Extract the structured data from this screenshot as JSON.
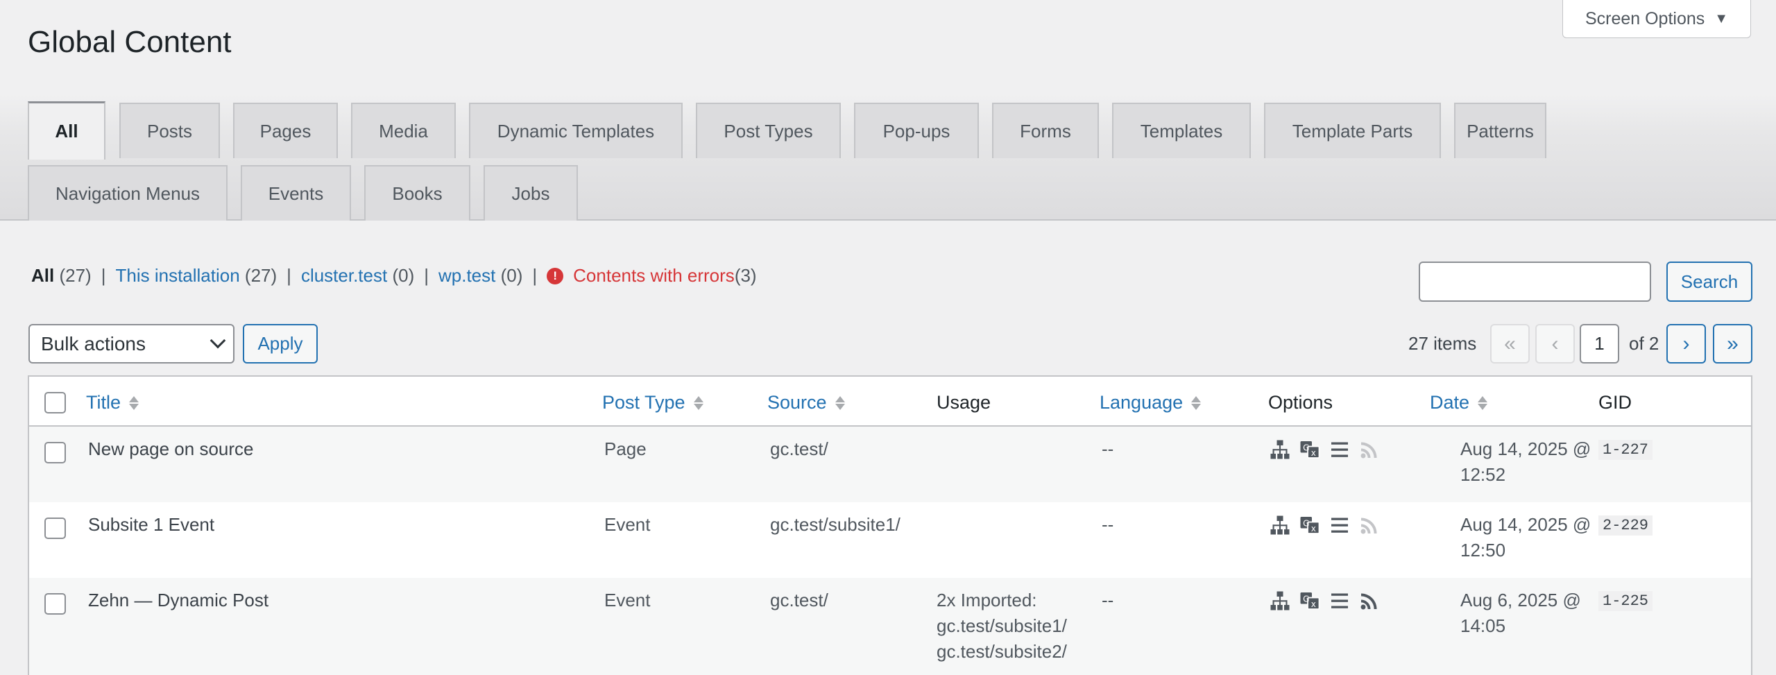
{
  "screen_options": {
    "label": "Screen Options",
    "caret": "▼"
  },
  "page_title": "Global Content",
  "tabs": [
    {
      "label": "All",
      "active": true
    },
    {
      "label": "Posts"
    },
    {
      "label": "Pages"
    },
    {
      "label": "Media"
    },
    {
      "label": "Dynamic Templates"
    },
    {
      "label": "Post Types"
    },
    {
      "label": "Pop-ups"
    },
    {
      "label": "Forms"
    },
    {
      "label": "Templates"
    },
    {
      "label": "Template Parts"
    },
    {
      "label": "Patterns"
    },
    {
      "label": "Navigation Menus"
    },
    {
      "label": "Events"
    },
    {
      "label": "Books"
    },
    {
      "label": "Jobs"
    }
  ],
  "views": {
    "all": {
      "label": "All",
      "count": "(27)"
    },
    "installation": {
      "label": "This installation",
      "count": "(27)"
    },
    "cluster": {
      "label": "cluster.test",
      "count": "(0)"
    },
    "wp": {
      "label": "wp.test",
      "count": "(0)"
    },
    "errors": {
      "label": "Contents with errors",
      "count": "(3)",
      "icon": "!"
    },
    "separator": "|"
  },
  "search": {
    "value": "",
    "button": "Search"
  },
  "bulk": {
    "selected": "Bulk actions",
    "apply": "Apply"
  },
  "pagination": {
    "items": "27 items",
    "first": "«",
    "prev": "‹",
    "current": "1",
    "of": "of 2",
    "next": "›",
    "last": "»"
  },
  "columns": {
    "title": "Title",
    "post_type": "Post Type",
    "source": "Source",
    "usage": "Usage",
    "language": "Language",
    "options": "Options",
    "date": "Date",
    "gid": "GID"
  },
  "rows": [
    {
      "title": "New page on source",
      "post_type": "Page",
      "source": "gc.test/",
      "usage_count": "",
      "usage_label": "",
      "usage_links": [],
      "language": "--",
      "date_line1": "Aug 14, 2025 @",
      "date_line2": "12:52",
      "gid": "1-227",
      "feed_active": false
    },
    {
      "title": "Subsite 1 Event",
      "post_type": "Event",
      "source": "gc.test/subsite1/",
      "usage_count": "",
      "usage_label": "",
      "usage_links": [],
      "language": "--",
      "date_line1": "Aug 14, 2025 @",
      "date_line2": "12:50",
      "gid": "2-229",
      "feed_active": false
    },
    {
      "title": "Zehn — Dynamic Post",
      "post_type": "Event",
      "source": "gc.test/",
      "usage_count": "2x",
      "usage_label": " Imported:",
      "usage_links": [
        "gc.test/subsite1/",
        "gc.test/subsite2/"
      ],
      "language": "--",
      "date_line1": "Aug 6, 2025 @",
      "date_line2": "14:05",
      "gid": "1-225",
      "feed_active": true
    }
  ],
  "option_icons": [
    "sitemap-icon",
    "translate-icon",
    "list-icon",
    "rss-icon"
  ],
  "colors": {
    "link": "#2271b1",
    "error": "#d63638",
    "muted_icon": "#c3c4c7",
    "icon": "#50575e"
  }
}
